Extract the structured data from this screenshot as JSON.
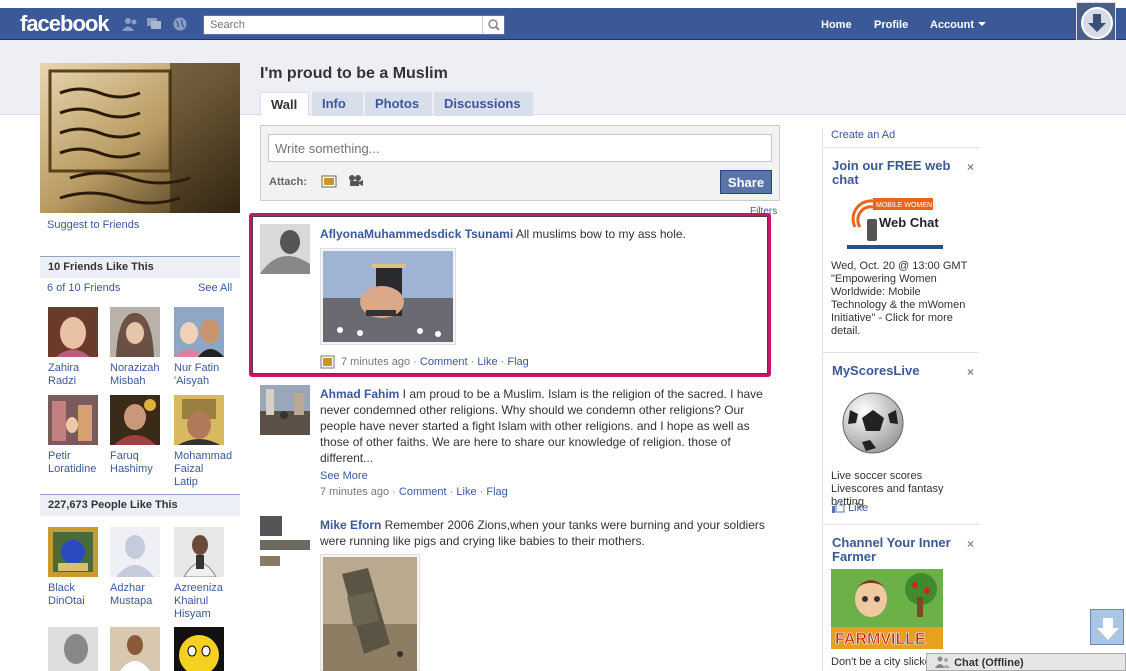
{
  "topbar": {
    "logo": "facebook",
    "search_placeholder": "Search",
    "nav": {
      "home": "Home",
      "profile": "Profile",
      "account": "Account"
    }
  },
  "page": {
    "title": "I'm proud to be a Muslim",
    "tabs": [
      {
        "label": "Wall"
      },
      {
        "label": "Info"
      },
      {
        "label": "Photos"
      },
      {
        "label": "Discussions"
      }
    ]
  },
  "left": {
    "suggest": "Suggest to Friends",
    "friends_section": {
      "heading": "10 Friends Like This",
      "sub": "6 of 10 Friends",
      "see_all": "See All",
      "friends": [
        {
          "name": "Zahira Radzi"
        },
        {
          "name": "Norazizah Misbah"
        },
        {
          "name": "Nur Fatin 'Aisyah"
        },
        {
          "name": "Petir Loratidine"
        },
        {
          "name": "Faruq Hashimy"
        },
        {
          "name": "Mohammad Faizal Latip"
        }
      ]
    },
    "people_section": {
      "heading": "227,673 People Like This",
      "people": [
        {
          "name": "Black DinOtai"
        },
        {
          "name": "Adzhar Mustapa"
        },
        {
          "name": "Azreeniza Khairul Hisyam"
        }
      ]
    }
  },
  "composer": {
    "placeholder": "Write something...",
    "attach": "Attach:",
    "share": "Share",
    "filters": "Filters"
  },
  "stories": [
    {
      "author": "AflyonaMuhammedsdick Tsunami",
      "text": " All muslims bow to my ass hole.",
      "time": "7 minutes ago",
      "actions": {
        "comment": "Comment",
        "like": "Like",
        "flag": "Flag"
      }
    },
    {
      "author": "Ahmad Fahim",
      "text": " I am proud to be a Muslim. Islam is the religion of the sacred. I have never condemned other religions. Why should we condemn other religions? Our people have never started a fight Islam with other religions. and I hope as well as those of other faiths. We are here to share our knowledge of religion. those of different...",
      "see_more": "See More",
      "time": "7 minutes ago",
      "actions": {
        "comment": "Comment",
        "like": "Like",
        "flag": "Flag"
      }
    },
    {
      "author": "Mike Eforn",
      "text": " Remember 2006 Zions,when your tanks were burning and your soldiers were running like pigs and crying like babies to their mothers."
    }
  ],
  "sep": "·",
  "right": {
    "create_ad": "Create an Ad",
    "ads": [
      {
        "title": "Join our FREE web chat",
        "close": "×",
        "logo_top": "MOBILE WOMEN",
        "logo_main": "Web Chat",
        "body": "Wed, Oct. 20 @ 13:00 GMT \"Empowering Women Worldwide: Mobile Technology & the mWomen Initiative\" - Click for more detail."
      },
      {
        "title": "MyScoresLive",
        "close": "×",
        "body": "Live soccer scores Livescores and fantasy betting",
        "like": "Like"
      },
      {
        "title": "Channel Your Inner Farmer",
        "close": "×",
        "logo_text": "FARMVILLE",
        "body": "Don't be a city slicker"
      }
    ]
  },
  "chat": {
    "label": "Chat (Offline)"
  }
}
